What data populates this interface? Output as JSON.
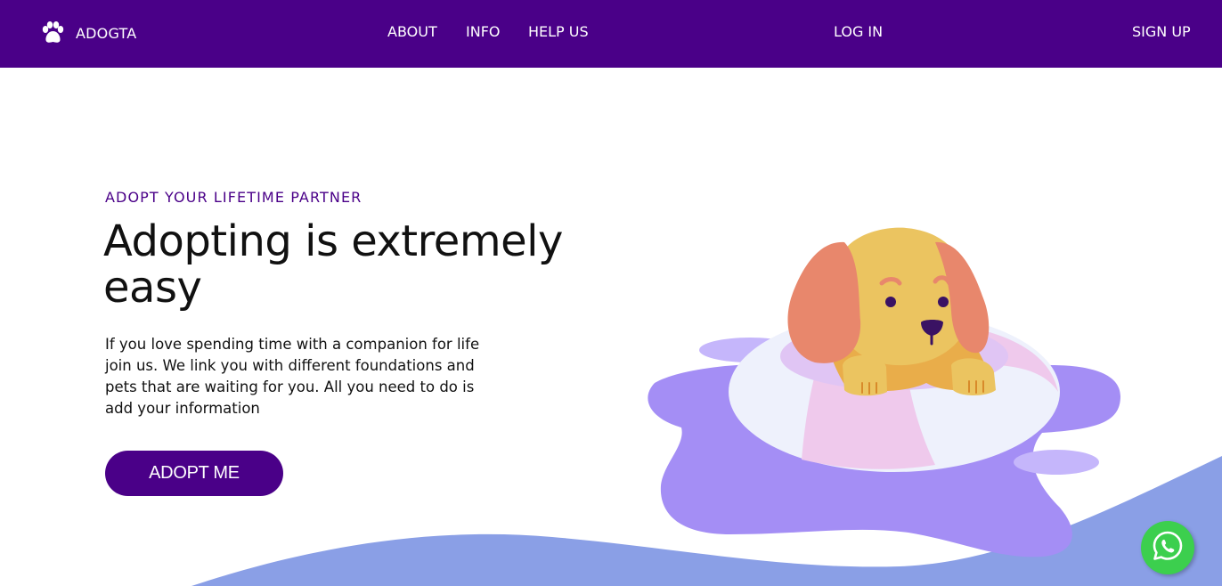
{
  "brand": {
    "name": "ADOGTA",
    "icon": "paw-icon"
  },
  "nav": {
    "about": "ABOUT",
    "info": "INFO",
    "help_us": "HELP US",
    "log_in": "LOG IN",
    "sign_up": "SIGN UP"
  },
  "hero": {
    "eyebrow": "ADOPT YOUR LIFETIME PARTNER",
    "headline": "Adopting is extremely easy",
    "description": "If you love spending time with a companion for life join us. We link you with different foundations and pets that are waiting for you. All you need to do is add your information",
    "cta_label": "ADOPT ME"
  },
  "floating": {
    "chat_icon": "whatsapp-icon"
  },
  "colors": {
    "brand_purple": "#4a0088",
    "wave_blue": "#8a9fe6",
    "splash_purple": "#a48ef5",
    "whatsapp_green": "#3ccf4e"
  }
}
